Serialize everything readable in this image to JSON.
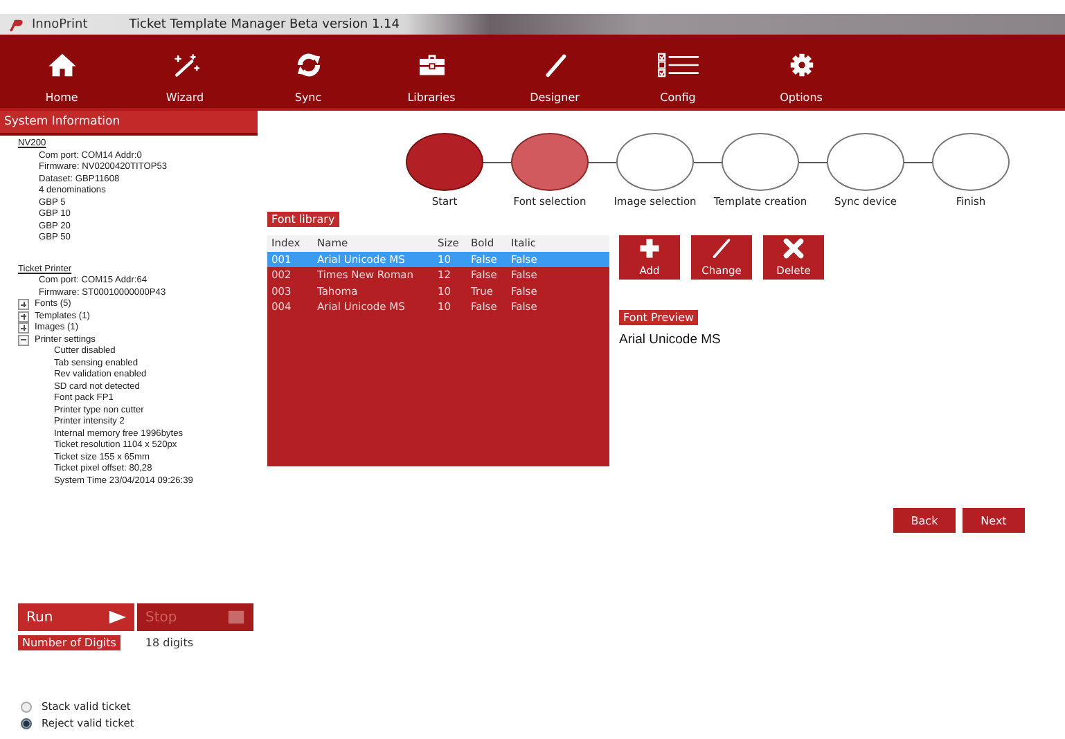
{
  "window": {
    "app_name": "InnoPrint",
    "title": "Ticket Template Manager Beta version 1.14"
  },
  "toolbar": [
    {
      "label": "Home"
    },
    {
      "label": "Wizard"
    },
    {
      "label": "Sync"
    },
    {
      "label": "Libraries"
    },
    {
      "label": "Designer"
    },
    {
      "label": "Config"
    },
    {
      "label": "Options"
    }
  ],
  "sidebar": {
    "title": "System Information",
    "sections": [
      {
        "heading": "NV200",
        "items": [
          {
            "label": "Com port: COM14 Addr:0"
          },
          {
            "label": "Firmware: NV0200420TITOP53"
          },
          {
            "label": "Dataset: GBP11608"
          },
          {
            "label": "4 denominations"
          },
          {
            "label": "GBP 5"
          },
          {
            "label": "GBP 10"
          },
          {
            "label": "GBP 20"
          },
          {
            "label": "GBP 50"
          }
        ]
      },
      {
        "heading": "Ticket Printer",
        "items": [
          {
            "label": "Com port: COM15 Addr:64"
          },
          {
            "label": "Firmware: ST00010000000P43"
          },
          {
            "label": "Fonts (5)",
            "expanded": false
          },
          {
            "label": "Templates (1)",
            "expanded": false
          },
          {
            "label": "Images (1)",
            "expanded": false
          },
          {
            "label": "Printer settings",
            "expanded": true,
            "children": [
              {
                "label": "Cutter disabled"
              },
              {
                "label": "Tab sensing enabled"
              },
              {
                "label": "Rev validation enabled"
              },
              {
                "label": "SD card not detected"
              },
              {
                "label": "Font pack FP1"
              },
              {
                "label": "Printer type non cutter"
              },
              {
                "label": "Printer intensity 2"
              },
              {
                "label": "Internal memory free 1996bytes"
              },
              {
                "label": "Ticket resolution 1104 x 520px"
              },
              {
                "label": "Ticket size 155 x 65mm"
              },
              {
                "label": "Ticket pixel offset: 80,28"
              },
              {
                "label": "System Time 23/04/2014 09:26:39"
              }
            ]
          }
        ]
      }
    ]
  },
  "run_controls": [
    {
      "label": "Run",
      "disabled": false
    },
    {
      "label": "Stop",
      "disabled": true
    }
  ],
  "digits": {
    "label": "Number of Digits",
    "value": "18 digits"
  },
  "ticket_options": [
    {
      "label": "Stack valid ticket",
      "selected": false
    },
    {
      "label": "Reject valid ticket",
      "selected": true
    }
  ],
  "steps": [
    {
      "label": "Start",
      "completed": true,
      "selected": false
    },
    {
      "label": "Font selection",
      "completed": false,
      "selected": true
    },
    {
      "label": "Image selection",
      "completed": false,
      "selected": false
    },
    {
      "label": "Template creation",
      "completed": false,
      "selected": false
    },
    {
      "label": "Sync device",
      "completed": false,
      "selected": false
    },
    {
      "label": "Finish",
      "completed": false,
      "selected": false
    }
  ],
  "font_library": {
    "title": "Font library",
    "columns": [
      "Index",
      "Name",
      "Size",
      "Bold",
      "Italic"
    ],
    "rows": [
      {
        "cells": [
          "001",
          "Arial Unicode MS",
          "10",
          "False",
          "False"
        ],
        "selected": true
      },
      {
        "cells": [
          "002",
          "Times New Roman",
          "12",
          "False",
          "False"
        ],
        "selected": false
      },
      {
        "cells": [
          "003",
          "Tahoma",
          "10",
          "True",
          "False"
        ],
        "selected": false
      },
      {
        "cells": [
          "004",
          "Arial Unicode MS",
          "10",
          "False",
          "False"
        ],
        "selected": false
      }
    ]
  },
  "actions": [
    {
      "label": "Add"
    },
    {
      "label": "Change"
    },
    {
      "label": "Delete"
    }
  ],
  "font_preview": {
    "title": "Font Preview",
    "text": "Arial Unicode MS"
  },
  "nav_buttons": [
    "Back",
    "Next"
  ]
}
